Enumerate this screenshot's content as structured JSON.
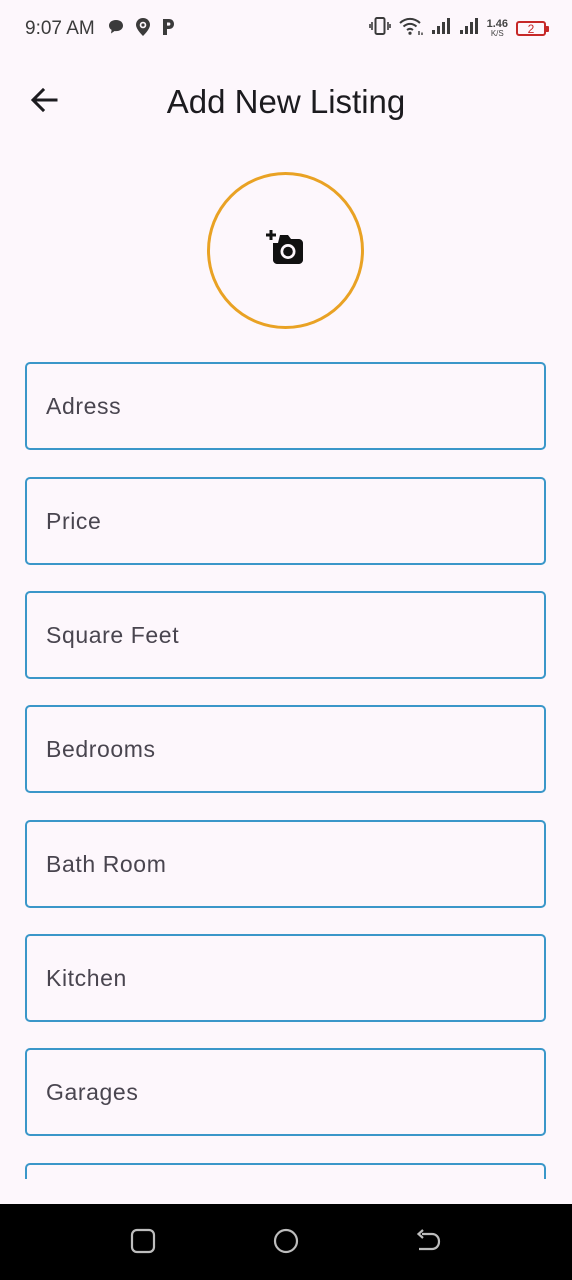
{
  "status_bar": {
    "time": "9:07 AM",
    "net_speed_value": "1.46",
    "net_speed_unit": "K/S",
    "battery_level": "2",
    "icons": [
      "chat-bubble-icon",
      "location-pin-icon",
      "parking-icon",
      "vibrate-icon",
      "wifi-icon",
      "signal-icon",
      "signal-icon"
    ]
  },
  "app_bar": {
    "title": "Add New Listing",
    "back_icon": "arrow-back-icon"
  },
  "photo_picker": {
    "icon": "add-a-photo-icon",
    "border_color": "#e9a224"
  },
  "form": {
    "fields": [
      {
        "label": "Adress"
      },
      {
        "label": "Price"
      },
      {
        "label": "Square Feet"
      },
      {
        "label": "Bedrooms"
      },
      {
        "label": "Bath Room"
      },
      {
        "label": "Kitchen"
      },
      {
        "label": "Garages"
      }
    ],
    "border_color": "#3a97c9"
  },
  "nav_bar": {
    "buttons": [
      "recents-icon",
      "home-icon",
      "back-icon"
    ]
  },
  "colors": {
    "background": "#fdf7fc",
    "accent_blue": "#3a97c9",
    "accent_orange": "#e9a224",
    "battery_red": "#c62828"
  }
}
